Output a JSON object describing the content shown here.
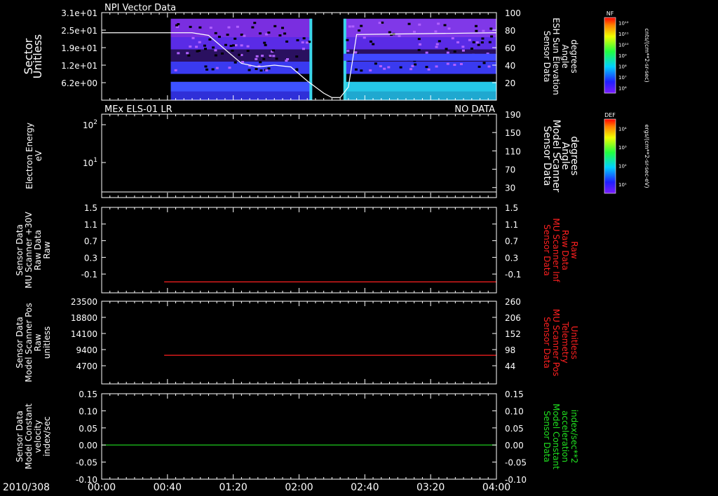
{
  "time_axis": {
    "date_label": "2010/308",
    "ticks": [
      "00:00",
      "00:40",
      "01:20",
      "02:00",
      "02:40",
      "03:20",
      "04:00"
    ]
  },
  "panels": [
    {
      "id": "npi",
      "title_left": "NPI Vector Data",
      "title_right": "",
      "left_label": [
        "Sector",
        "Unitless"
      ],
      "left_ticks": [
        "3.1e+01",
        "2.5e+01",
        "1.9e+01",
        "1.2e+01",
        "6.2e+00"
      ],
      "right_label": [
        "Sensor Data",
        "ESH Sun Elevation",
        "Angle",
        "degrees"
      ],
      "right_ticks": [
        "100",
        "80",
        "60",
        "40",
        "20"
      ],
      "right_label_color": "#ffffff"
    },
    {
      "id": "els",
      "title_left": "MEx ELS-01 LR",
      "title_right": "NO DATA",
      "left_label": [
        "Electron Energy",
        "eV"
      ],
      "left_ticks": [
        "10",
        "10"
      ],
      "left_tick_exp": [
        "2",
        "1"
      ],
      "right_label": [
        "Sensor Data",
        "Model Scanner",
        "Angle",
        "degrees"
      ],
      "right_ticks": [
        "190",
        "150",
        "110",
        "70",
        "30"
      ],
      "right_label_color": "#ffffff"
    },
    {
      "id": "mu30",
      "title_left": "",
      "title_right": "",
      "left_label": [
        "Sensor Data",
        "MU Scanner +30V",
        "Raw Data",
        "Raw"
      ],
      "left_ticks": [
        "1.5",
        "1.1",
        "0.7",
        "0.3",
        "-0.1"
      ],
      "right_label": [
        "Sensor Data",
        "MU Scanner Inf",
        "Raw Data",
        "Raw"
      ],
      "right_ticks": [
        "1.5",
        "1.1",
        "0.7",
        "0.3",
        "-0.1"
      ],
      "right_label_color": "#ff2020"
    },
    {
      "id": "scanpos",
      "title_left": "",
      "title_right": "",
      "left_label": [
        "Sensor Data",
        "Model Scanner Pos",
        "Raw",
        "unitless"
      ],
      "left_ticks": [
        "23500",
        "18800",
        "14100",
        "9400",
        "4700"
      ],
      "right_label": [
        "Sensor Data",
        "MU Scanner Pos",
        "Telemetry",
        "Unitless"
      ],
      "right_ticks": [
        "260",
        "206",
        "152",
        "98",
        "44"
      ],
      "right_label_color": "#ff2020"
    },
    {
      "id": "vel",
      "title_left": "",
      "title_right": "",
      "left_label": [
        "Sensor Data",
        "Model Constant",
        "velocity",
        "index/sec"
      ],
      "left_ticks": [
        "0.15",
        "0.10",
        "0.05",
        "0.00",
        "-0.05",
        "-0.10"
      ],
      "right_label": [
        "Sensor Data",
        "Model Constant",
        "acceleration",
        "index/sec**2"
      ],
      "right_ticks": [
        "0.15",
        "0.10",
        "0.05",
        "0.00",
        "-0.05",
        "-0.10"
      ],
      "right_label_color": "#20e020"
    }
  ],
  "colorbars": [
    {
      "title": "NF",
      "unit": "cnts/(cm**2-sr-sec)",
      "ticks": [
        "10¹²",
        "10¹¹",
        "10¹⁰",
        "10⁹",
        "10⁸",
        "10⁷",
        "10⁶"
      ]
    },
    {
      "title": "DEF",
      "unit": "ergs/(cm**2-sr-sec-eV)",
      "ticks": [
        "10⁴",
        "10³",
        "10²",
        "10¹"
      ]
    }
  ],
  "chart_data": [
    {
      "type": "heatmap",
      "title": "NPI Vector Data",
      "xlabel": "",
      "ylabel": "Sector Unitless",
      "xlim": [
        "00:00",
        "04:00"
      ],
      "ylim": [
        0,
        31
      ],
      "data_intervals": [
        [
          "00:42",
          "02:08"
        ],
        [
          "02:27",
          "04:00"
        ]
      ],
      "line_series": {
        "name": "ESH Sun Elevation Angle",
        "unit": "degrees",
        "ylim": [
          0,
          100
        ],
        "x": [
          "00:00",
          "00:40",
          "00:55",
          "01:05",
          "01:15",
          "01:25",
          "01:35",
          "01:45",
          "01:55",
          "02:05",
          "02:15",
          "02:20",
          "02:25",
          "02:30",
          "02:35",
          "04:00"
        ],
        "y": [
          77,
          77,
          77,
          74,
          58,
          42,
          38,
          40,
          38,
          22,
          8,
          3,
          3,
          15,
          75,
          77
        ]
      }
    },
    {
      "type": "line",
      "title": "MEx ELS-01 LR",
      "status": "NO DATA",
      "xlim": [
        "00:00",
        "04:00"
      ],
      "series": [
        {
          "name": "Model Scanner Angle",
          "unit": "degrees",
          "x": [
            "00:00",
            "04:00"
          ],
          "y": [
            10,
            10
          ]
        }
      ],
      "ylim_right": [
        10,
        190
      ]
    },
    {
      "type": "line",
      "xlim": [
        "00:00",
        "04:00"
      ],
      "ylim": [
        -0.3,
        1.5
      ],
      "series": [
        {
          "name": "MU Scanner Inf Raw Data",
          "color": "#ff2020",
          "x": [
            "00:38",
            "04:00"
          ],
          "y": [
            -0.07,
            -0.07
          ]
        }
      ]
    },
    {
      "type": "line",
      "xlim": [
        "00:00",
        "04:00"
      ],
      "ylim_right": [
        0,
        260
      ],
      "series": [
        {
          "name": "MU Scanner Pos Telemetry",
          "color": "#ff2020",
          "x": [
            "00:38",
            "04:00"
          ],
          "y": [
            90,
            90
          ]
        }
      ]
    },
    {
      "type": "line",
      "xlim": [
        "00:00",
        "04:00"
      ],
      "ylim": [
        -0.1,
        0.15
      ],
      "series": [
        {
          "name": "Model Constant velocity",
          "color": "#20e020",
          "x": [
            "00:00",
            "04:00"
          ],
          "y": [
            0.0,
            0.0
          ]
        }
      ]
    }
  ]
}
